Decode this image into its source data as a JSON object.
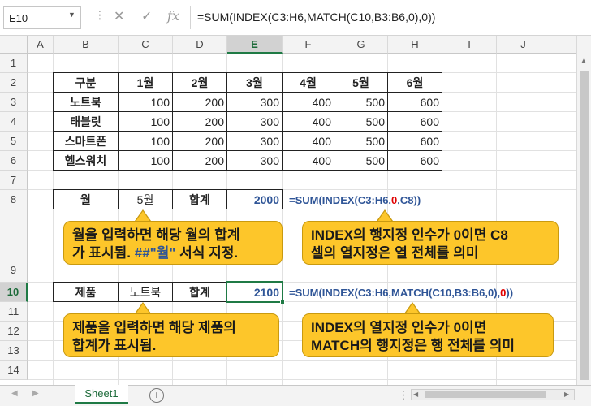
{
  "formula_bar": {
    "name_box": "E10",
    "cancel_icon": "✕",
    "enter_icon": "✓",
    "fx_label": "fx",
    "formula": "=SUM(INDEX(C3:H6,MATCH(C10,B3:B6,0),0))"
  },
  "columns": [
    "A",
    "B",
    "C",
    "D",
    "E",
    "F",
    "G",
    "H",
    "I",
    "J"
  ],
  "rows": [
    "1",
    "2",
    "3",
    "4",
    "5",
    "6",
    "7",
    "8",
    "9",
    "10",
    "11",
    "12",
    "13",
    "14"
  ],
  "table": {
    "headers": [
      "구분",
      "1월",
      "2월",
      "3월",
      "4월",
      "5월",
      "6월"
    ],
    "rows": [
      {
        "label": "노트북",
        "values": [
          "100",
          "200",
          "300",
          "400",
          "500",
          "600"
        ]
      },
      {
        "label": "태블릿",
        "values": [
          "100",
          "200",
          "300",
          "400",
          "500",
          "600"
        ]
      },
      {
        "label": "스마트폰",
        "values": [
          "100",
          "200",
          "300",
          "400",
          "500",
          "600"
        ]
      },
      {
        "label": "헬스워치",
        "values": [
          "100",
          "200",
          "300",
          "400",
          "500",
          "600"
        ]
      }
    ]
  },
  "row8": {
    "label": "월",
    "month": "5월",
    "sum_label": "합계",
    "sum_value": "2000",
    "formula_a": "=SUM(INDEX(C3:H6,",
    "formula_b": "0",
    "formula_c": ",C8))"
  },
  "row10": {
    "label": "제품",
    "product": "노트북",
    "sum_label": "합계",
    "sum_value": "2100",
    "formula_a": "=SUM(INDEX(C3:H6,MATCH(C10,B3:B6,0),",
    "formula_b": "0",
    "formula_c": "))"
  },
  "callouts": {
    "c1_line1": "월을 입력하면 해당 월의 합계",
    "c1_line2a": "가 표시됨. ",
    "c1_line2b": "##\"월\"",
    "c1_line2c": " 서식 지정.",
    "c2_line1": "INDEX의 행지정 인수가 0이면 C8",
    "c2_line2": "셀의 열지정은 열 전체를 의미",
    "c3_line1": "제품을 입력하면 해당 제품의",
    "c3_line2": "합계가 표시됨.",
    "c4_line1": "INDEX의 열지정 인수가 0이면",
    "c4_line2": "MATCH의 행지정은 행 전체를 의미"
  },
  "sheet_tabs": {
    "active": "Sheet1",
    "add_icon": "+"
  },
  "colors": {
    "accent": "#1f7a45",
    "callout": "#fdc62a",
    "formula_blue": "#2f5597",
    "red": "#e00000"
  }
}
